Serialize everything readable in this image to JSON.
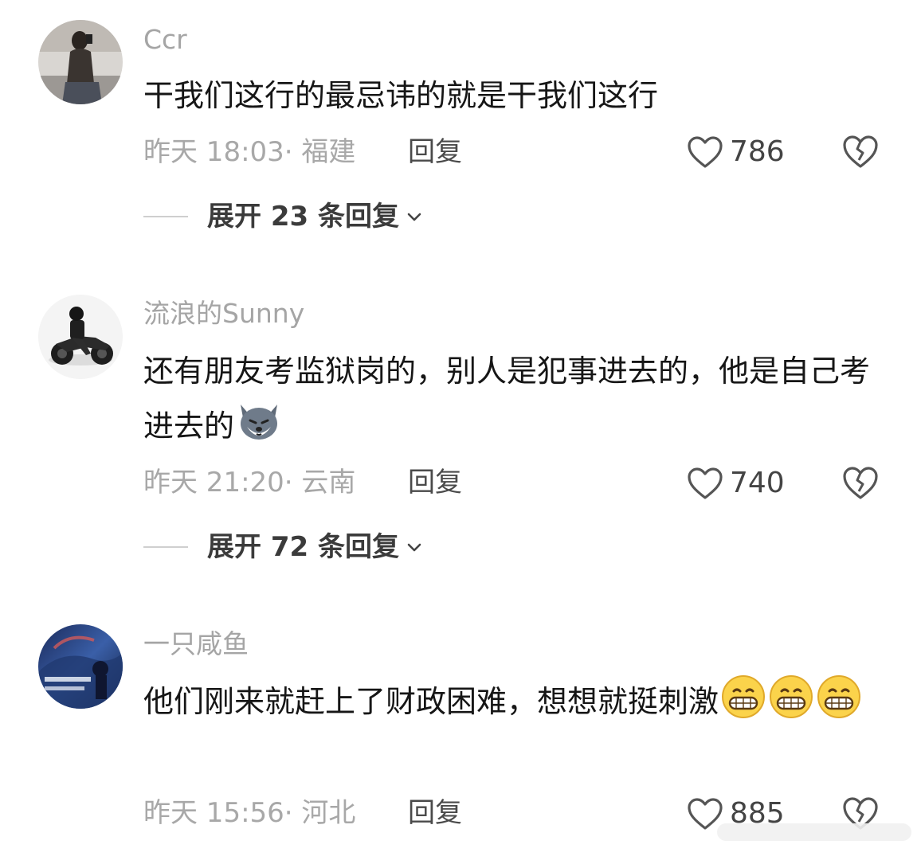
{
  "comments": [
    {
      "username": "Ccr",
      "text": "干我们这行的最忌讳的就是干我们这行",
      "meta": "昨天 18:03· 福建",
      "reply_label": "回复",
      "likes": "786",
      "expand_label": "展开 23 条回复"
    },
    {
      "username": "流浪的Sunny",
      "text": "还有朋友考监狱岗的，别人是犯事进去的，他是自己考进去的",
      "meta": "昨天 21:20· 云南",
      "reply_label": "回复",
      "likes": "740",
      "expand_label": "展开 72 条回复"
    },
    {
      "username": "一只咸鱼",
      "text": "他们刚来就赶上了财政困难，想想就挺刺激",
      "meta": "昨天 15:56· 河北",
      "reply_label": "回复",
      "likes": "885"
    }
  ],
  "icons": {
    "like": "heart-outline-icon",
    "dislike": "broken-heart-icon",
    "expand": "chevron-down-icon",
    "emoji_wolf": "wolf-emoji",
    "emoji_grin": "grinning-face-emoji"
  },
  "colors": {
    "background": "#ffffff",
    "username": "#a5a5a5",
    "text": "#161616",
    "meta": "#a8a8a8"
  }
}
